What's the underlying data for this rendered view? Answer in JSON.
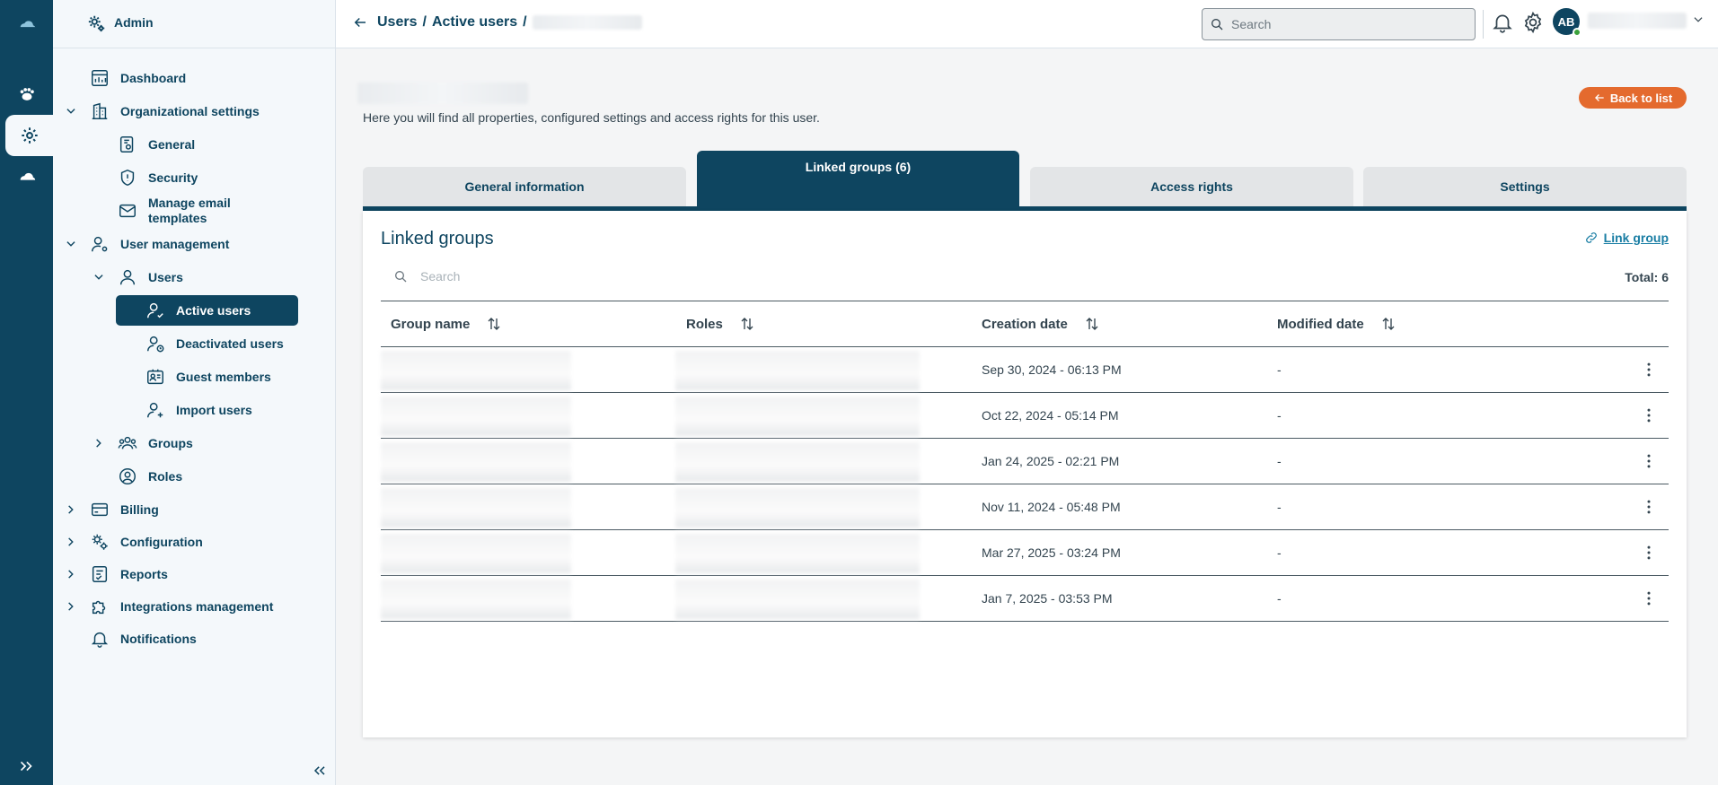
{
  "app": {
    "admin_label": "Admin"
  },
  "breadcrumb": {
    "items": [
      "Users",
      "Active users"
    ],
    "separator": "/"
  },
  "header": {
    "search_placeholder": "Search",
    "avatar_initials": "AB"
  },
  "sidebar": {
    "items": [
      {
        "label": "Dashboard",
        "icon": "dashboard-icon"
      },
      {
        "label": "Organizational settings",
        "icon": "building-icon"
      },
      {
        "label": "General",
        "icon": "document-gear-icon"
      },
      {
        "label": "Security",
        "icon": "shield-icon"
      },
      {
        "label": "Manage email templates",
        "icon": "mail-icon"
      },
      {
        "label": "User management",
        "icon": "user-gear-icon"
      },
      {
        "label": "Users",
        "icon": "user-icon"
      },
      {
        "label": "Active users",
        "icon": "user-check-icon"
      },
      {
        "label": "Deactivated users",
        "icon": "user-clock-icon"
      },
      {
        "label": "Guest members",
        "icon": "id-card-icon"
      },
      {
        "label": "Import users",
        "icon": "user-plus-icon"
      },
      {
        "label": "Groups",
        "icon": "group-icon"
      },
      {
        "label": "Roles",
        "icon": "role-icon"
      },
      {
        "label": "Billing",
        "icon": "card-icon"
      },
      {
        "label": "Configuration",
        "icon": "gears-icon"
      },
      {
        "label": "Reports",
        "icon": "report-icon"
      },
      {
        "label": "Integrations management",
        "icon": "puzzle-icon"
      },
      {
        "label": "Notifications",
        "icon": "bell-icon"
      }
    ]
  },
  "page": {
    "intro": "Here you will find all properties, configured settings and access rights for this user.",
    "back_to_list": "Back to list",
    "tabs": [
      "General information",
      "Linked groups (6)",
      "Access rights",
      "Settings"
    ],
    "active_tab": "Linked groups (6)"
  },
  "panel": {
    "title": "Linked groups",
    "link_group": "Link group",
    "search_placeholder": "Search",
    "total": "Total: 6",
    "columns": [
      "Group name",
      "Roles",
      "Creation date",
      "Modified date"
    ],
    "rows": [
      {
        "creation_date": "Sep 30, 2024 - 06:13 PM",
        "modified_date": "-"
      },
      {
        "creation_date": "Oct 22, 2024 - 05:14 PM",
        "modified_date": "-"
      },
      {
        "creation_date": "Jan 24, 2025 - 02:21 PM",
        "modified_date": "-"
      },
      {
        "creation_date": "Nov 11, 2024 - 05:48 PM",
        "modified_date": "-"
      },
      {
        "creation_date": "Mar 27, 2025 - 03:24 PM",
        "modified_date": "-"
      },
      {
        "creation_date": "Jan 7, 2025 - 03:53 PM",
        "modified_date": "-"
      }
    ]
  },
  "colors": {
    "primary": "#0e4560",
    "accent": "#e46a2e",
    "link": "#1a7ea4",
    "online": "#3ca23c"
  }
}
